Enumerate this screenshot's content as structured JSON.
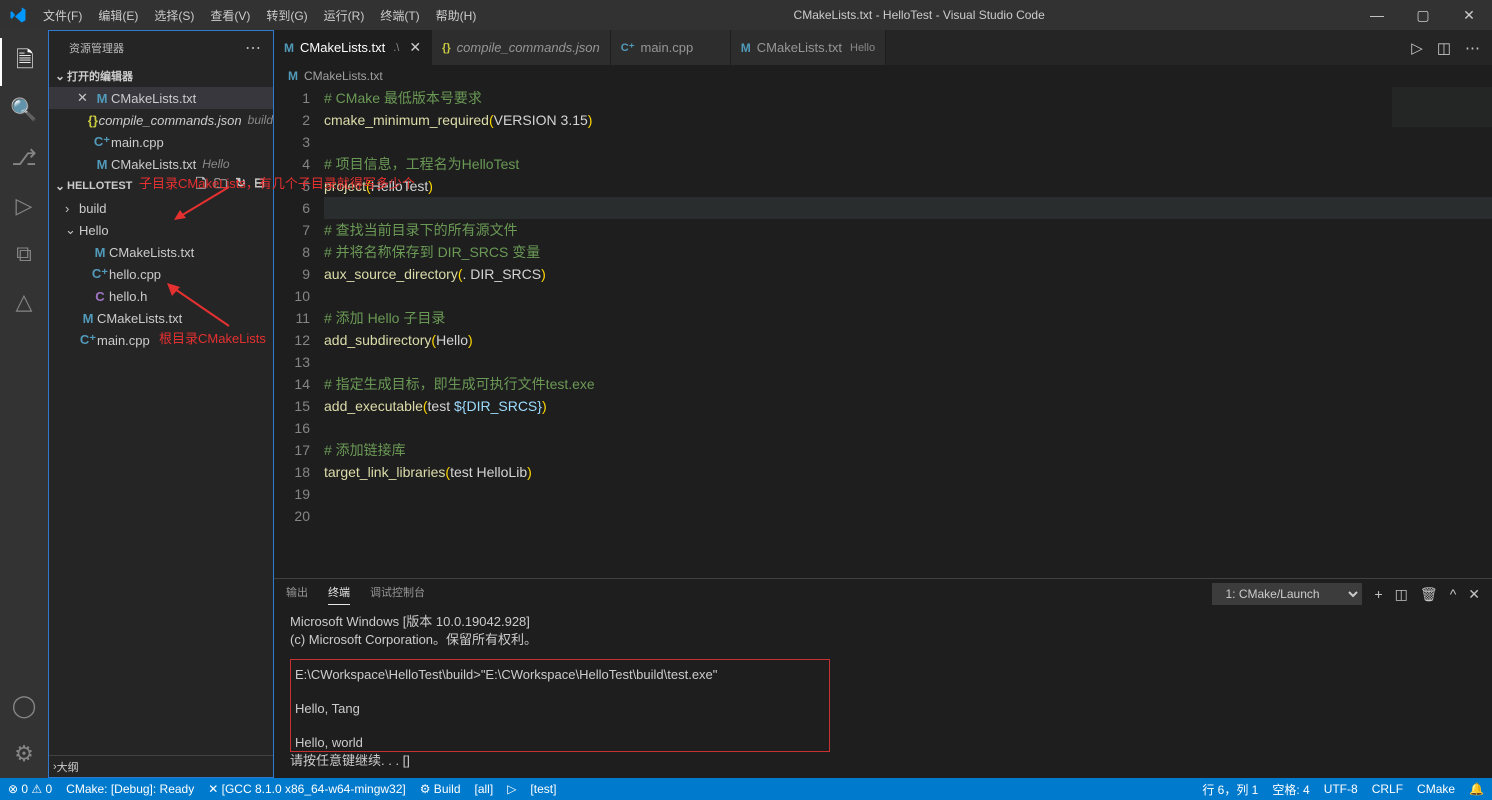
{
  "window": {
    "title": "CMakeLists.txt - HelloTest - Visual Studio Code"
  },
  "menus": [
    "文件(F)",
    "编辑(E)",
    "选择(S)",
    "查看(V)",
    "转到(G)",
    "运行(R)",
    "终端(T)",
    "帮助(H)"
  ],
  "sidebar": {
    "title": "资源管理器",
    "open_editors": "打开的编辑器",
    "open_items": [
      {
        "iconClass": "ic-m",
        "icon": "M",
        "name": "CMakeLists.txt",
        "close": "✕",
        "active": true
      },
      {
        "iconClass": "ic-js",
        "icon": "{}",
        "name": "compile_commands.json",
        "suffix": "build",
        "italic": true
      },
      {
        "iconClass": "ic-cpp",
        "icon": "C⁺",
        "name": "main.cpp"
      },
      {
        "iconClass": "ic-m",
        "icon": "M",
        "name": "CMakeLists.txt",
        "suffix": "Hello"
      }
    ],
    "project": "HELLOTEST",
    "files": [
      {
        "indent": "ind1",
        "chev": "›",
        "name": "build"
      },
      {
        "indent": "ind1",
        "chev": "⌄",
        "name": "Hello"
      },
      {
        "indent": "ind2",
        "iconClass": "ic-m",
        "icon": "M",
        "name": "CMakeLists.txt"
      },
      {
        "indent": "ind2",
        "iconClass": "ic-cpp",
        "icon": "C⁺",
        "name": "hello.cpp"
      },
      {
        "indent": "ind2",
        "iconClass": "ic-c",
        "icon": "C",
        "name": "hello.h"
      },
      {
        "indent": "ind1",
        "iconClass": "ic-m",
        "icon": "M",
        "name": "CMakeLists.txt"
      },
      {
        "indent": "ind1",
        "iconClass": "ic-cpp",
        "icon": "C⁺",
        "name": "main.cpp"
      }
    ],
    "outline": "大纲"
  },
  "tabs": [
    {
      "iconClass": "ic-m",
      "icon": "M",
      "name": "CMakeLists.txt",
      "sub": ".\\",
      "active": true,
      "close": "✕"
    },
    {
      "iconClass": "ic-js",
      "icon": "{}",
      "name": "compile_commands.json",
      "italic": true
    },
    {
      "iconClass": "ic-cpp",
      "icon": "C⁺",
      "name": "main.cpp"
    },
    {
      "iconClass": "ic-m",
      "icon": "M",
      "name": "CMakeLists.txt",
      "sub": "Hello"
    }
  ],
  "breadcrumb": {
    "icon": "M",
    "name": "CMakeLists.txt"
  },
  "code": {
    "lines": [
      {
        "n": 1,
        "seg": [
          {
            "c": "c-comment",
            "t": "# CMake 最低版本号要求"
          }
        ]
      },
      {
        "n": 2,
        "seg": [
          {
            "c": "c-func",
            "t": "cmake_minimum_required"
          },
          {
            "c": "c-paren",
            "t": "("
          },
          {
            "c": "c-str",
            "t": "VERSION 3.15"
          },
          {
            "c": "c-paren",
            "t": ")"
          }
        ]
      },
      {
        "n": 3,
        "seg": []
      },
      {
        "n": 4,
        "seg": [
          {
            "c": "c-comment",
            "t": "# 项目信息，工程名为HelloTest"
          }
        ]
      },
      {
        "n": 5,
        "seg": [
          {
            "c": "c-func",
            "t": "project"
          },
          {
            "c": "c-paren",
            "t": "("
          },
          {
            "c": "c-str",
            "t": "HelloTest"
          },
          {
            "c": "c-paren",
            "t": ")"
          }
        ]
      },
      {
        "n": 6,
        "hl": true,
        "seg": []
      },
      {
        "n": 7,
        "seg": [
          {
            "c": "c-comment",
            "t": "# 查找当前目录下的所有源文件"
          }
        ]
      },
      {
        "n": 8,
        "seg": [
          {
            "c": "c-comment",
            "t": "# 并将名称保存到 DIR_SRCS 变量"
          }
        ]
      },
      {
        "n": 9,
        "seg": [
          {
            "c": "c-func",
            "t": "aux_source_directory"
          },
          {
            "c": "c-paren",
            "t": "("
          },
          {
            "c": "c-str",
            "t": ". DIR_SRCS"
          },
          {
            "c": "c-paren",
            "t": ")"
          }
        ]
      },
      {
        "n": 10,
        "seg": []
      },
      {
        "n": 11,
        "seg": [
          {
            "c": "c-comment",
            "t": "# 添加 Hello 子目录"
          }
        ]
      },
      {
        "n": 12,
        "seg": [
          {
            "c": "c-func",
            "t": "add_subdirectory"
          },
          {
            "c": "c-paren",
            "t": "("
          },
          {
            "c": "c-str",
            "t": "Hello"
          },
          {
            "c": "c-paren",
            "t": ")"
          }
        ]
      },
      {
        "n": 13,
        "seg": []
      },
      {
        "n": 14,
        "seg": [
          {
            "c": "c-comment",
            "t": "# 指定生成目标，即生成可执行文件test.exe"
          }
        ]
      },
      {
        "n": 15,
        "seg": [
          {
            "c": "c-func",
            "t": "add_executable"
          },
          {
            "c": "c-paren",
            "t": "("
          },
          {
            "c": "c-str",
            "t": "test "
          },
          {
            "c": "c-var",
            "t": "${DIR_SRCS}"
          },
          {
            "c": "c-paren",
            "t": ")"
          }
        ]
      },
      {
        "n": 16,
        "seg": []
      },
      {
        "n": 17,
        "seg": [
          {
            "c": "c-comment",
            "t": "# 添加链接库"
          }
        ]
      },
      {
        "n": 18,
        "seg": [
          {
            "c": "c-func",
            "t": "target_link_libraries"
          },
          {
            "c": "c-paren",
            "t": "("
          },
          {
            "c": "c-str",
            "t": "test HelloLib"
          },
          {
            "c": "c-paren",
            "t": ")"
          }
        ]
      },
      {
        "n": 19,
        "seg": []
      },
      {
        "n": 20,
        "seg": []
      }
    ]
  },
  "panel": {
    "tabs": [
      "输出",
      "终端",
      "调试控制台"
    ],
    "active": 1,
    "select": "1: CMake/Launch",
    "terminal": {
      "pre": "Microsoft Windows [版本 10.0.19042.928]\n(c) Microsoft Corporation。保留所有权利。",
      "box": "E:\\CWorkspace\\HelloTest\\build>\"E:\\CWorkspace\\HelloTest\\build\\test.exe\"\n\nHello, Tang\n\nHello, world",
      "post": "请按任意键继续. . . []"
    }
  },
  "status": {
    "left": [
      "⊗ 0 ⚠ 0",
      "CMake: [Debug]: Ready",
      "✕ [GCC 8.1.0 x86_64-w64-mingw32]",
      "⚙ Build",
      "[all]",
      "▷",
      "[test]"
    ],
    "right": [
      "行 6，列 1",
      "空格: 4",
      "UTF-8",
      "CRLF",
      "CMake",
      "🔔"
    ]
  },
  "annotations": {
    "a1": "子目录CMakeLists，有几个子目录就得写多少个",
    "a2": "根目录CMakeLists"
  }
}
